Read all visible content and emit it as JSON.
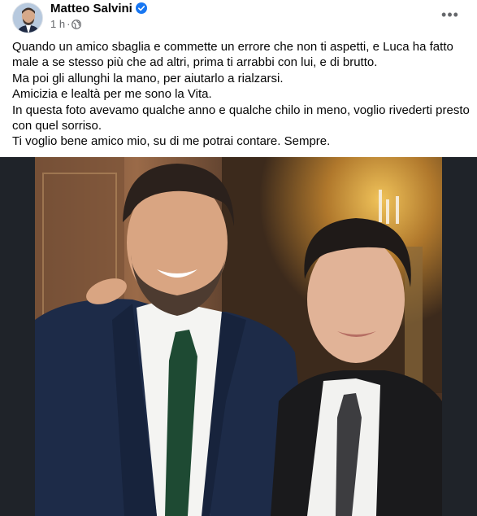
{
  "post": {
    "author": "Matteo Salvini",
    "time": "1 h",
    "separator": "·",
    "more_label": "•••",
    "paragraphs": [
      "Quando un amico sbaglia e commette un errore che non ti aspetti, e Luca ha fatto male a se stesso più che ad altri, prima ti arrabbi con lui, e di brutto.",
      "Ma poi gli allunghi la mano, per aiutarlo a rialzarsi.",
      "Amicizia e lealtà per me sono la Vita.",
      "In questa foto avevamo qualche anno e qualche chilo in meno, voglio rivederti presto con quel sorriso.",
      "Ti voglio bene amico mio, su di me potrai contare. Sempre."
    ]
  },
  "icons": {
    "verified": "verified-badge-icon",
    "audience": "globe-icon",
    "more": "more-options-icon"
  },
  "colors": {
    "verified": "#1877f2",
    "secondary_text": "#65676b",
    "primary_text": "#050505"
  }
}
